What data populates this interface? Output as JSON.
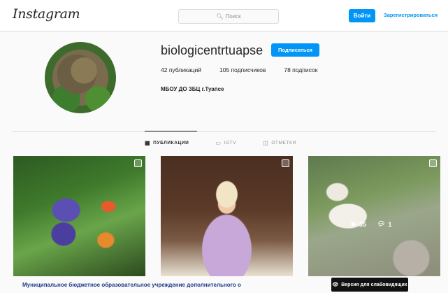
{
  "header": {
    "logo": "Instagram",
    "search_placeholder": "Поиск",
    "login_label": "Войти",
    "signup_label": "Зарегистрироваться"
  },
  "profile": {
    "username": "biologicentrtuapse",
    "follow_label": "Подписаться",
    "stats": {
      "posts": "42 публикаций",
      "followers": "105 подписчиков",
      "following": "78 подписок"
    },
    "bio": "МБОУ ДО ЗБЦ г.Туапсе"
  },
  "tabs": [
    {
      "label": "Публикации",
      "icon": "grid-icon",
      "active": true
    },
    {
      "label": "IGTV",
      "icon": "tv-icon",
      "active": false
    },
    {
      "label": "Отметки",
      "icon": "tag-icon",
      "active": false
    }
  ],
  "posts": [
    {
      "alt": "flowers",
      "badge": "carousel-icon"
    },
    {
      "alt": "woman at desk",
      "badge": "carousel-icon"
    },
    {
      "alt": "goat video",
      "badge": "carousel-icon",
      "views": "35",
      "comments": "1"
    }
  ],
  "footer": {
    "caption": "Муниципальное бюджетное образовательное учреждение дополнительного о",
    "weak_vision_label": "Версия для слабовидящих"
  },
  "colors": {
    "accent": "#0095f6",
    "text": "#262626",
    "muted": "#8e8e8e",
    "border": "#dbdbdb"
  }
}
